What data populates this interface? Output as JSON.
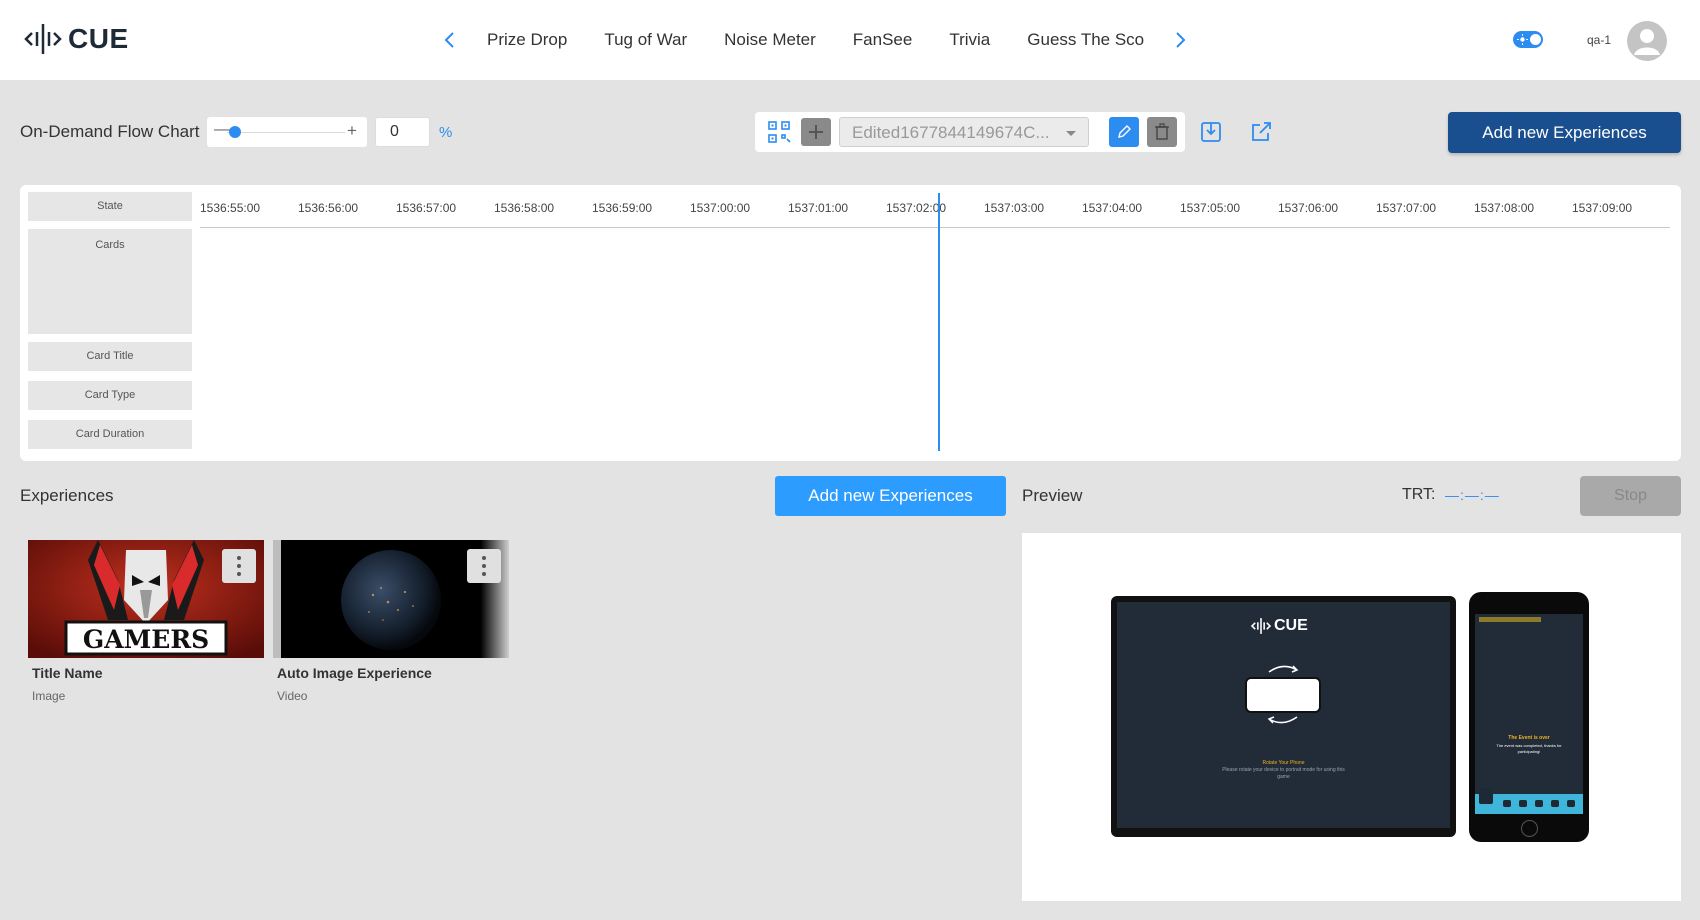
{
  "app": {
    "logo_text": "CUE"
  },
  "nav": {
    "tabs": [
      "Prize Drop",
      "Tug of War",
      "Noise Meter",
      "FanSee",
      "Trivia",
      "Guess The Sco"
    ]
  },
  "user": {
    "name": "qa-1"
  },
  "toolbar": {
    "title": "On-Demand Flow Chart",
    "zoom_percent": "0",
    "percent_sign": "%",
    "selected_flow": "Edited1677844149674C...",
    "add_button": "Add new Experiences"
  },
  "chart": {
    "row_labels": [
      "State",
      "Cards",
      "Card Title",
      "Card Type",
      "Card Duration"
    ],
    "ticks": [
      "1536:55:00",
      "1536:56:00",
      "1536:57:00",
      "1536:58:00",
      "1536:59:00",
      "1537:00:00",
      "1537:01:00",
      "1537:02:00",
      "1537:03:00",
      "1537:04:00",
      "1537:05:00",
      "1537:06:00",
      "1537:07:00",
      "1537:08:00",
      "1537:09:00"
    ]
  },
  "experiences": {
    "title": "Experiences",
    "add_button": "Add new Experiences",
    "cards": [
      {
        "title": "Title Name",
        "type": "Image",
        "thumb_text": "GAMERS"
      },
      {
        "title": "Auto Image Experience",
        "type": "Video"
      }
    ]
  },
  "preview": {
    "title": "Preview",
    "trt_label": "TRT:",
    "trt_value": "—:—:—",
    "stop_button": "Stop",
    "tablet_logo": "CUE",
    "tablet_title": "Rotate Your Phone",
    "tablet_desc": "Please rotate your device to portrait mode for using this game",
    "phone_title": "The Event is over",
    "phone_desc": "The event was completed, thanks for participating!"
  },
  "colors": {
    "accent": "#2d8cf0",
    "primary_dark": "#1a4f8f",
    "button_blue": "#2d9cff",
    "background": "#e3e3e3"
  }
}
